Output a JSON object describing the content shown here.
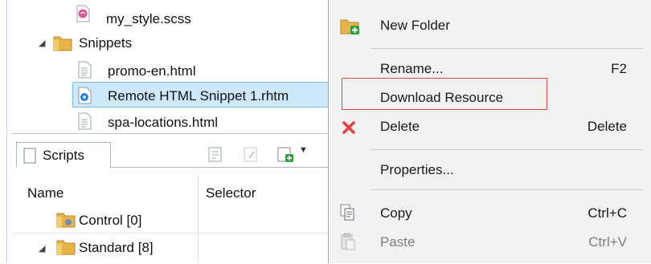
{
  "tree": {
    "items": [
      {
        "label": "my_style.scss",
        "icon": "sass-file-icon"
      },
      {
        "label": "Snippets",
        "icon": "folder-icon",
        "expanded": true
      },
      {
        "label": "promo-en.html",
        "icon": "html-file-icon"
      },
      {
        "label": "Remote HTML Snippet 1.rhtm",
        "icon": "remote-snippet-icon",
        "selected": true
      },
      {
        "label": "spa-locations.html",
        "icon": "html-file-icon"
      }
    ]
  },
  "scripts_panel": {
    "tab_label": "Scripts",
    "columns": [
      "Name",
      "Selector"
    ],
    "rows": [
      {
        "label": "Control [0]",
        "icon": "control-folder-icon"
      },
      {
        "label": "Standard [8]",
        "icon": "folder-icon"
      }
    ]
  },
  "context_menu": {
    "items": [
      {
        "label": "New Folder",
        "shortcut": "",
        "icon": "new-folder-icon"
      },
      {
        "label": "Rename...",
        "shortcut": "F2",
        "icon": ""
      },
      {
        "label": "Download Resource",
        "shortcut": "",
        "icon": "",
        "highlighted": true
      },
      {
        "label": "Delete",
        "shortcut": "Delete",
        "icon": "delete-icon"
      },
      {
        "label": "Properties...",
        "shortcut": "",
        "icon": ""
      },
      {
        "label": "Copy",
        "shortcut": "Ctrl+C",
        "icon": "copy-icon"
      },
      {
        "label": "Paste",
        "shortcut": "Ctrl+V",
        "icon": "paste-icon",
        "disabled": true
      }
    ]
  },
  "colors": {
    "highlight_box": "#e0464a",
    "selection": "#cde8fb",
    "menu_bg": "#f2f2f2"
  }
}
